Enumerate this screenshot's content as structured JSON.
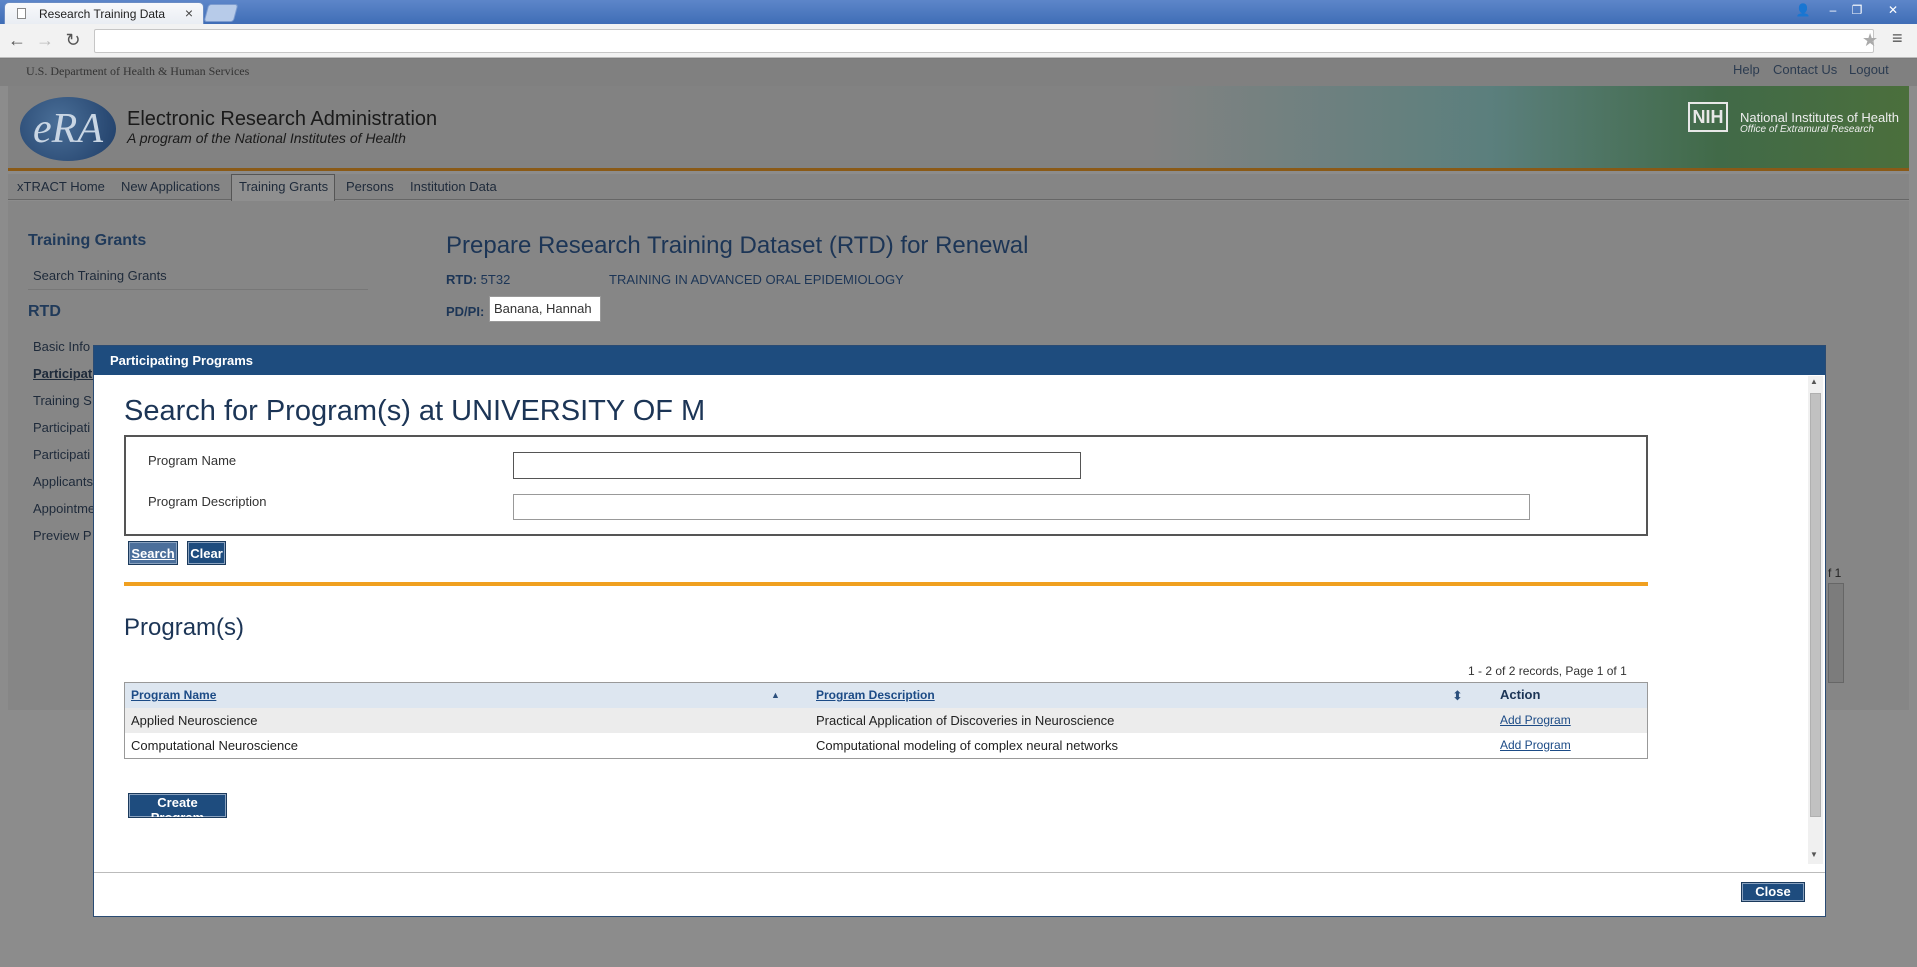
{
  "browser": {
    "tab_title": "Research Training Data",
    "tab_close": "×",
    "nav_back": "←",
    "nav_forward": "→",
    "nav_reload": "↻",
    "star": "★",
    "menu": "≡",
    "win_user": "👤",
    "win_min": "–",
    "win_max": "❐",
    "win_close": "✕"
  },
  "header": {
    "hhs": "U.S. Department of Health & Human Services",
    "links": [
      "Help",
      "Contact Us",
      "Logout"
    ],
    "era_logo": "eRA",
    "era_title": "Electronic Research Administration",
    "era_subtitle": "A program of the National Institutes of Health",
    "nih_badge": "NIH",
    "nih_name": "National Institutes of Health",
    "nih_office": "Office of Extramural Research"
  },
  "nav": {
    "items": [
      "xTRACT Home",
      "New Applications",
      "Training Grants",
      "Persons",
      "Institution Data"
    ],
    "active": "Training Grants"
  },
  "sidebar": {
    "title": "Training Grants",
    "search_link": "Search Training Grants",
    "section": "RTD",
    "items": [
      "Basic Info",
      "Participati",
      "Training S",
      "Participati",
      "Participati",
      "Applicants",
      "Appointme",
      "Preview P"
    ]
  },
  "main": {
    "title": "Prepare Research Training Dataset (RTD) for Renewal",
    "rtd_label": "RTD:",
    "rtd_value": "5T32",
    "rtd_title": "TRAINING IN ADVANCED ORAL EPIDEMIOLOGY",
    "pdpi_label": "PD/PI:",
    "pdpi_value": "Banana, Hannah",
    "bg_page_fragment": "f 1"
  },
  "modal": {
    "title": "Participating Programs",
    "search_heading": "Search for Program(s) at UNIVERSITY OF M",
    "program_name_label": "Program Name",
    "program_name_value": "",
    "program_desc_label": "Program Description",
    "program_desc_value": "",
    "search_button": "Search",
    "clear_button": "Clear",
    "results_heading": "Program(s)",
    "records_text": "1 - 2 of 2 records, Page 1 of 1",
    "columns": [
      "Program Name",
      "Program Description",
      "Action"
    ],
    "sort_asc": "▲",
    "sort_both": "⬍",
    "rows": [
      {
        "name": "Applied Neuroscience",
        "description": "Practical Application of Discoveries in Neuroscience",
        "action": "Add Program"
      },
      {
        "name": "Computational Neuroscience",
        "description": "Computational modeling of complex neural networks",
        "action": "Add Program"
      }
    ],
    "create_button": "Create Program",
    "close_button": "Close",
    "scroll_up": "▲",
    "scroll_down": "▼"
  },
  "colors": {
    "modal_header": "#1e4c7e",
    "accent_orange": "#f0a020",
    "link_blue": "#1c4b86"
  }
}
